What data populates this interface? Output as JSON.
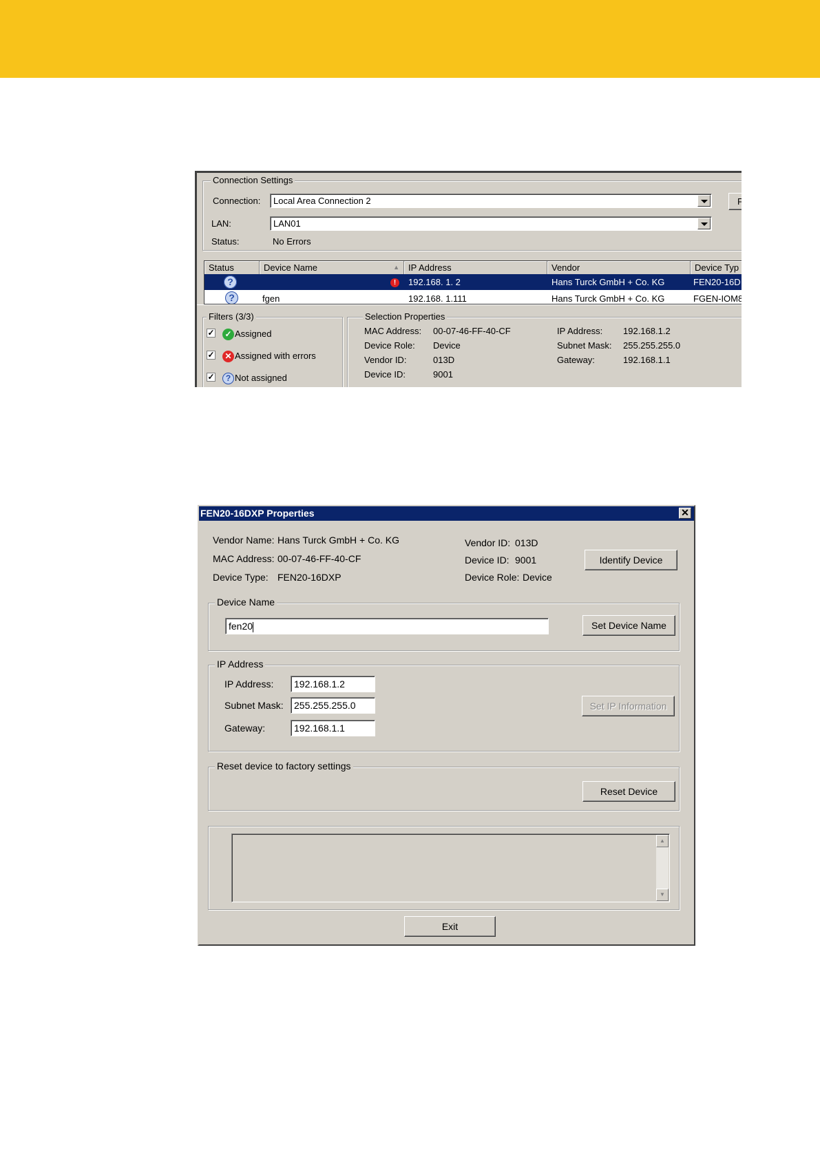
{
  "connection_window": {
    "connection_settings": {
      "title": "Connection Settings",
      "connection_label": "Connection:",
      "connection_value": "Local Area Connection 2",
      "lan_label": "LAN:",
      "lan_value": "LAN01",
      "status_label": "Status:",
      "status_value": "No Errors",
      "side_button_label": "F"
    },
    "device_table": {
      "columns": [
        "Status",
        "Device Name",
        "IP Address",
        "Vendor",
        "Device Typ"
      ],
      "rows": [
        {
          "device_name": "",
          "ip": "192.168.  1.  2",
          "vendor": "Hans Turck GmbH + Co. KG",
          "device_type": "FEN20-16D",
          "selected": true
        },
        {
          "device_name": "fgen",
          "ip": "192.168.  1.111",
          "vendor": "Hans Turck GmbH + Co. KG",
          "device_type": "FGEN-IOM8",
          "selected": false
        }
      ]
    },
    "filters": {
      "title": "Filters  (3/3)",
      "items": [
        "Assigned",
        "Assigned with errors",
        "Not assigned"
      ]
    },
    "selection_properties": {
      "title": "Selection Properties",
      "mac_label": "MAC Address:",
      "mac_value": "00-07-46-FF-40-CF",
      "role_label": "Device Role:",
      "role_value": "Device",
      "vendor_id_label": "Vendor ID:",
      "vendor_id_value": "013D",
      "device_id_label": "Device ID:",
      "device_id_value": "9001",
      "ip_label": "IP Address:",
      "ip_value": "192.168.1.2",
      "subnet_label": "Subnet Mask:",
      "subnet_value": "255.255.255.0",
      "gateway_label": "Gateway:",
      "gateway_value": "192.168.1.1"
    }
  },
  "properties_dialog": {
    "title": "FEN20-16DXP Properties",
    "close_glyph": "✕",
    "vendor_name_label": "Vendor Name:",
    "vendor_name_value": "Hans Turck GmbH + Co. KG",
    "mac_label": "MAC Address:",
    "mac_value": "00-07-46-FF-40-CF",
    "device_type_label": "Device Type:",
    "device_type_value": "FEN20-16DXP",
    "vendor_id_label": "Vendor ID:",
    "vendor_id_value": "013D",
    "device_id_label": "Device ID:",
    "device_id_value": "9001",
    "device_role_label": "Device Role:",
    "device_role_value": "Device",
    "identify_button": "Identify Device",
    "device_name_group": "Device Name",
    "device_name_value": "fen20",
    "set_device_name_button": "Set Device Name",
    "ip_group": "IP Address",
    "ip_label": "IP Address:",
    "ip_value": "192.168.1.2",
    "subnet_label": "Subnet Mask:",
    "subnet_value": "255.255.255.0",
    "gateway_label": "Gateway:",
    "gateway_value": "192.168.1.1",
    "set_ip_button": "Set IP Information",
    "reset_group": "Reset device to factory settings",
    "reset_button": "Reset Device",
    "log_text": "",
    "exit_button": "Exit"
  },
  "colors": {
    "accent_yellow": "#f8c31a",
    "selection_blue": "#0a246a",
    "window_gray": "#d4d0c8"
  }
}
